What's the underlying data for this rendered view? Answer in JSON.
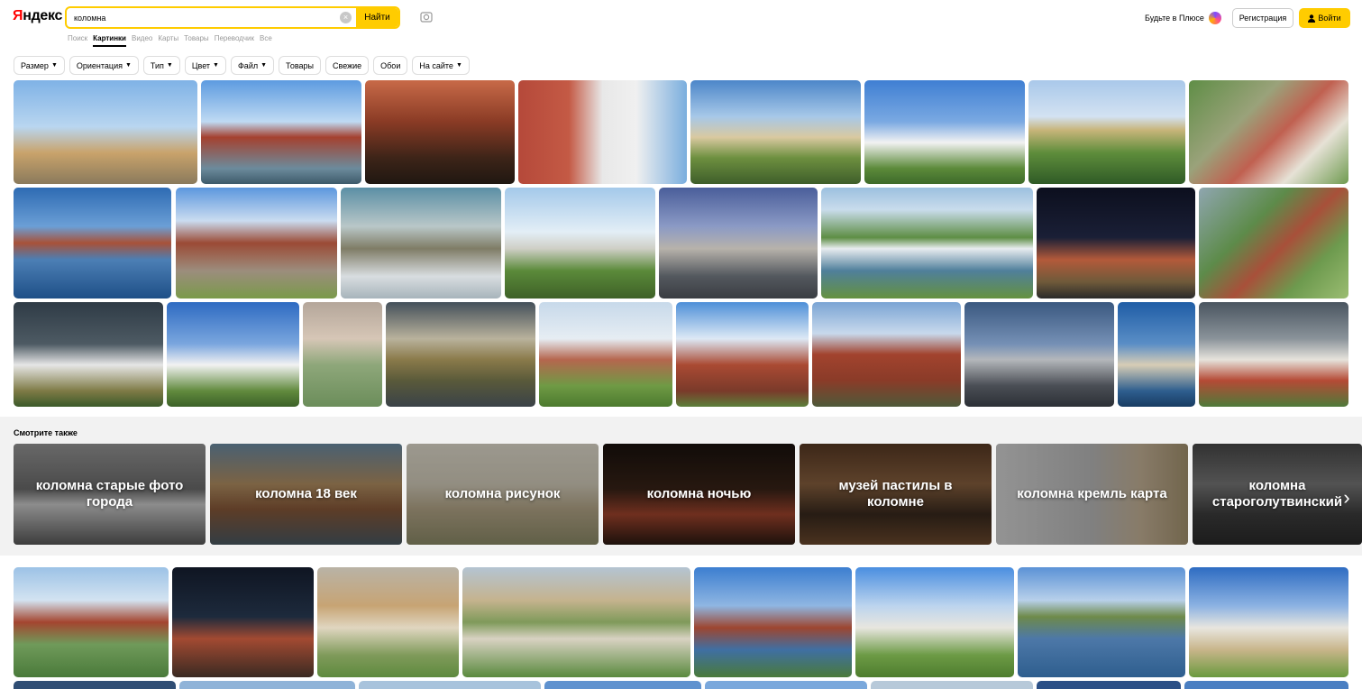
{
  "header": {
    "logo_first": "Я",
    "logo_rest": "ндекс",
    "search_value": "коломна",
    "clear_glyph": "×",
    "find_label": "Найти",
    "plus_label": "Будьте в Плюсе",
    "register_label": "Регистрация",
    "login_label": "Войти"
  },
  "nav": [
    "Поиск",
    "Картинки",
    "Видео",
    "Карты",
    "Товары",
    "Переводчик",
    "Все"
  ],
  "filters": [
    {
      "label": "Размер",
      "has_menu": true
    },
    {
      "label": "Ориентация",
      "has_menu": true
    },
    {
      "label": "Тип",
      "has_menu": true
    },
    {
      "label": "Цвет",
      "has_menu": true
    },
    {
      "label": "Файл",
      "has_menu": true
    },
    {
      "label": "Товары",
      "has_menu": false
    },
    {
      "label": "Свежие",
      "has_menu": false
    },
    {
      "label": "Обои",
      "has_menu": false
    },
    {
      "label": "На сайте",
      "has_menu": true
    }
  ],
  "see_also": {
    "title": "Смотрите также",
    "arrow_glyph": "›",
    "items": [
      "коломна старые фото города",
      "коломна 18 век",
      "коломна рисунок",
      "коломна ночью",
      "музей пастилы в коломне",
      "коломна кремль карта",
      "коломна староголутвинский"
    ]
  },
  "icons": {
    "search_clear": "close-icon",
    "camera": "camera-icon",
    "plus": "plus-icon",
    "user": "user-icon",
    "chevron": "chevron-down-icon",
    "next": "chevron-right-icon"
  },
  "colors": {
    "brand_yellow": "#ffcc00",
    "logo_red": "#ff0000",
    "see_also_bg": "#f2f2f2"
  }
}
